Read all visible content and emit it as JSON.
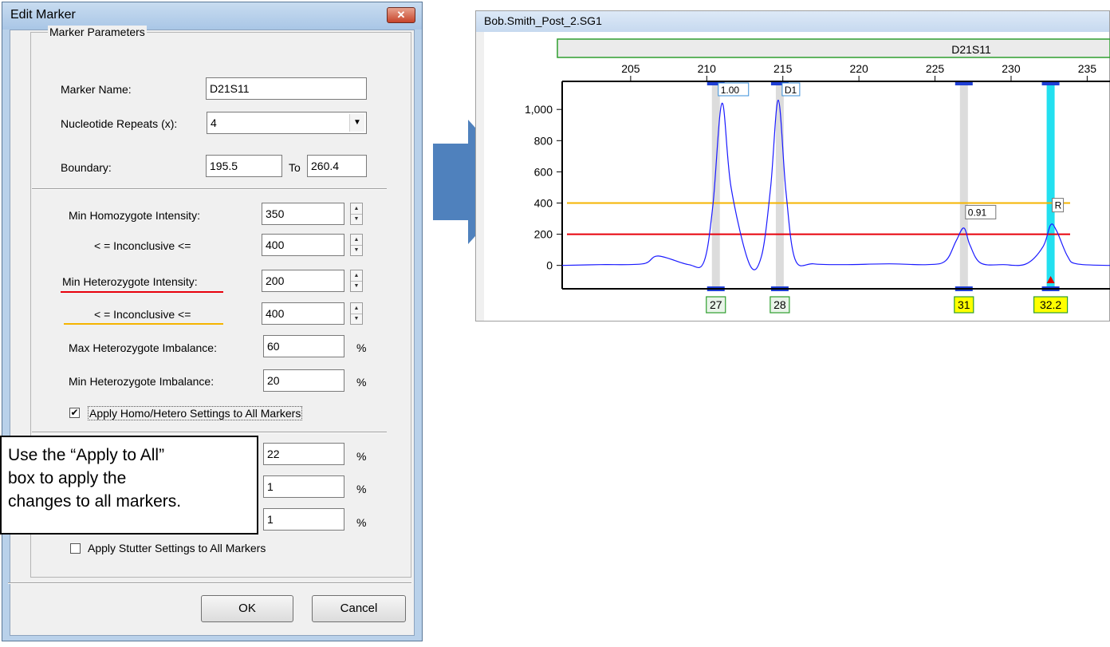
{
  "dialog": {
    "title": "Edit Marker",
    "close_glyph": "✕",
    "group_label": "Marker Parameters",
    "marker_name_label": "Marker Name:",
    "marker_name_value": "D21S11",
    "nucleotide_label": "Nucleotide Repeats (x):",
    "nucleotide_value": "4",
    "boundary_label": "Boundary:",
    "boundary_from": "195.5",
    "boundary_to_label": "To",
    "boundary_to": "260.4",
    "min_homo_label": "Min Homozygote Intensity:",
    "min_homo_value": "350",
    "homo_inconclusive_label": "< =  Inconclusive  <=",
    "homo_inconclusive_value": "400",
    "min_hetero_label": "Min Heterozygote Intensity:",
    "min_hetero_value": "200",
    "hetero_inconclusive_label": "< =  Inconclusive  <=",
    "hetero_inconclusive_value": "400",
    "max_imbalance_label": "Max Heterozygote Imbalance:",
    "max_imbalance_value": "60",
    "min_imbalance_label": "Min Heterozygote Imbalance:",
    "min_imbalance_value": "20",
    "percent": "%",
    "apply_homo_label": "Apply Homo/Hetero Settings to All Markers",
    "apply_homo_checked": true,
    "check_mark": "✔",
    "stutter_value_1": "22",
    "stutter_value_2": "1",
    "stutter_value_3": "1",
    "apply_stutter_label": "Apply Stutter Settings to All Markers",
    "apply_stutter_checked": false,
    "ok_label": "OK",
    "cancel_label": "Cancel",
    "underline_colors": {
      "hetero": "#e8000b",
      "inconclusive": "#f5b400"
    }
  },
  "callout": {
    "line1": "Use the “Apply to All”",
    "line2": "box to apply the",
    "line3": "changes to all markers."
  },
  "chart_window": {
    "title": "Bob.Smith_Post_2.SG1"
  },
  "chart_data": {
    "type": "line",
    "marker_label": "D21S11",
    "x_ticks": [
      205,
      210,
      215,
      220,
      225,
      230,
      235
    ],
    "xlim": [
      200.5,
      236.5
    ],
    "y_ticks": [
      0,
      200,
      400,
      600,
      800,
      "1,000"
    ],
    "ylim": [
      -150,
      1180
    ],
    "threshold_lines": [
      {
        "value": 400,
        "color": "#f5b400"
      },
      {
        "value": 200,
        "color": "#e8000b"
      }
    ],
    "trace_color": "#1a1aff",
    "trace": {
      "x": [
        200.5,
        203,
        205.8,
        206.8,
        208.8,
        209.8,
        210.4,
        211.0,
        211.6,
        212.8,
        213.6,
        214.2,
        214.7,
        215.2,
        215.8,
        217,
        219,
        222,
        224.5,
        225.7,
        226.4,
        226.9,
        227.3,
        228,
        229.5,
        231,
        232.1,
        232.6,
        233.0,
        233.7,
        234.3,
        236.5
      ],
      "y": [
        0,
        5,
        10,
        60,
        5,
        20,
        380,
        1040,
        500,
        10,
        60,
        500,
        1060,
        480,
        40,
        10,
        5,
        10,
        5,
        30,
        160,
        240,
        130,
        15,
        5,
        10,
        120,
        260,
        220,
        60,
        10,
        0
      ]
    },
    "peaks": [
      {
        "x": 210.6,
        "allele": "27",
        "top_label": "1.00",
        "highlight": "gray",
        "allele_bg": "#e9f4e9"
      },
      {
        "x": 214.8,
        "allele": "28",
        "top_label": "D1",
        "highlight": "gray",
        "allele_bg": "#e9f4e9"
      },
      {
        "x": 226.9,
        "allele": "31",
        "label": "0.91",
        "highlight": "gray",
        "allele_bg": "#ffff00"
      },
      {
        "x": 232.6,
        "allele": "32.2",
        "label": "R",
        "highlight": "cyan",
        "allele_bg": "#ffff00"
      }
    ]
  }
}
